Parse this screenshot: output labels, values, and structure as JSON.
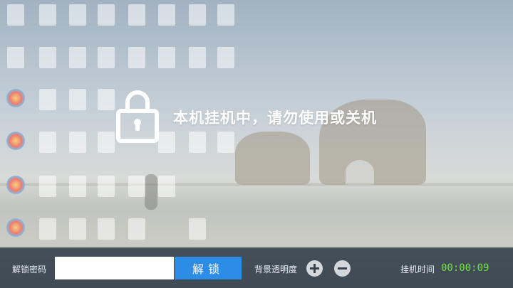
{
  "screen": {
    "title": "本机挂机中，请勿使用或关机",
    "lock_icon": "lock-icon"
  },
  "bottom_bar": {
    "password_label": "解锁密码",
    "password_value": "",
    "unlock_label": "解锁",
    "opacity_label": "背景透明度",
    "increase_icon": "plus-icon",
    "decrease_icon": "minus-icon",
    "timer_label": "挂机时间",
    "timer_value": "00:00:09"
  },
  "colors": {
    "unlock_button": "#2d8ce6",
    "timer": "#6fe53a",
    "bar": "#2d3a48"
  }
}
